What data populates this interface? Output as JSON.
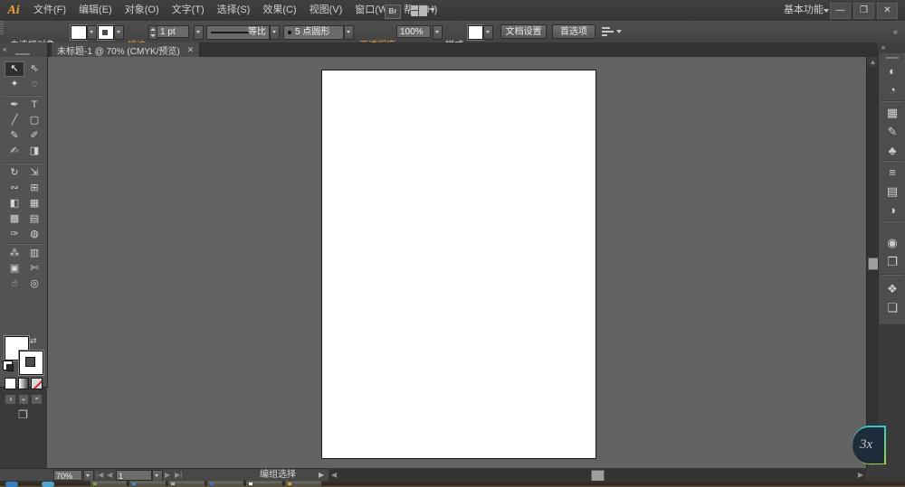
{
  "menu_bar": {
    "logo": "Ai",
    "items": [
      {
        "name": "menu-file",
        "label": "文件(F)"
      },
      {
        "name": "menu-edit",
        "label": "编辑(E)"
      },
      {
        "name": "menu-object",
        "label": "对象(O)"
      },
      {
        "name": "menu-type",
        "label": "文字(T)"
      },
      {
        "name": "menu-select",
        "label": "选择(S)"
      },
      {
        "name": "menu-effect",
        "label": "效果(C)"
      },
      {
        "name": "menu-view",
        "label": "视图(V)"
      },
      {
        "name": "menu-window",
        "label": "窗口(W)"
      },
      {
        "name": "menu-help",
        "label": "帮助(H)"
      }
    ],
    "bridge_label": "Br",
    "workspace_label": "基本功能",
    "window_controls": [
      {
        "name": "minimize-button",
        "glyph": "—"
      },
      {
        "name": "restore-button",
        "glyph": "❐"
      },
      {
        "name": "close-button",
        "glyph": "✕"
      }
    ]
  },
  "control_bar": {
    "selection_status": "未选择对象",
    "stroke_label": "描边:",
    "stroke_weight": "1 pt",
    "stroke_profile": "等比",
    "brush_definition": "5 点圆形",
    "opacity_label": "不透明度:",
    "opacity_value": "100%",
    "style_label": "样式:",
    "document_setup_label": "文档设置",
    "preferences_label": "首选项",
    "collapse_glyph": "«"
  },
  "tab": {
    "title": "未标题-1 @ 70% (CMYK/预览)",
    "close_glyph": "✕"
  },
  "tools": {
    "collapse_glyph": "«",
    "groups": [
      {
        "items": [
          {
            "name": "selection-tool",
            "glyph": "↖",
            "sel": true
          },
          {
            "name": "direct-selection-tool",
            "glyph": "⇖"
          },
          {
            "name": "magic-wand-tool",
            "glyph": "✦"
          },
          {
            "name": "lasso-tool",
            "glyph": "◌"
          }
        ]
      },
      {
        "items": [
          {
            "name": "pen-tool",
            "glyph": "✒"
          },
          {
            "name": "type-tool",
            "glyph": "T"
          },
          {
            "name": "line-segment-tool",
            "glyph": "╱"
          },
          {
            "name": "rectangle-tool",
            "glyph": "▢"
          },
          {
            "name": "paintbrush-tool",
            "glyph": "✎"
          },
          {
            "name": "pencil-tool",
            "glyph": "✐"
          },
          {
            "name": "blob-brush-tool",
            "glyph": "✍"
          },
          {
            "name": "eraser-tool",
            "glyph": "◨"
          }
        ]
      },
      {
        "items": [
          {
            "name": "rotate-tool",
            "glyph": "↻"
          },
          {
            "name": "scale-tool",
            "glyph": "⇲"
          },
          {
            "name": "width-tool",
            "glyph": "∾"
          },
          {
            "name": "free-transform-tool",
            "glyph": "⊞"
          },
          {
            "name": "shape-builder-tool",
            "glyph": "◧"
          },
          {
            "name": "perspective-grid-tool",
            "glyph": "▦"
          },
          {
            "name": "mesh-tool",
            "glyph": "▩"
          },
          {
            "name": "gradient-tool",
            "glyph": "▤"
          },
          {
            "name": "eyedropper-tool",
            "glyph": "✑"
          },
          {
            "name": "blend-tool",
            "glyph": "◍"
          }
        ]
      },
      {
        "items": [
          {
            "name": "symbol-sprayer-tool",
            "glyph": "⁂"
          },
          {
            "name": "column-graph-tool",
            "glyph": "▥"
          },
          {
            "name": "artboard-tool",
            "glyph": "▣"
          },
          {
            "name": "slice-tool",
            "glyph": "✄"
          },
          {
            "name": "hand-tool",
            "glyph": "☝"
          },
          {
            "name": "zoom-tool",
            "glyph": "◎"
          }
        ]
      }
    ],
    "swap-colors-glyph": "⇄",
    "color-modes": [
      {
        "name": "fill-color-mode"
      },
      {
        "name": "gradient-color-mode"
      },
      {
        "name": "none-color-mode"
      }
    ],
    "draw_modes": [
      {
        "name": "draw-normal-mode",
        "glyph": "◑"
      },
      {
        "name": "draw-behind-mode",
        "glyph": "◒"
      },
      {
        "name": "draw-inside-mode",
        "glyph": "◓"
      }
    ],
    "screen_mode_glyph": "❐"
  },
  "dock": {
    "collapse_glyph": "«",
    "groups": [
      {
        "items": [
          {
            "name": "color-panel-icon",
            "glyph": "◐"
          },
          {
            "name": "color-guide-panel-icon",
            "glyph": "◔"
          }
        ]
      },
      {
        "items": [
          {
            "name": "swatches-panel-icon",
            "glyph": "▦"
          },
          {
            "name": "brushes-panel-icon",
            "glyph": "✎"
          },
          {
            "name": "symbols-panel-icon",
            "glyph": "♣"
          }
        ]
      },
      {
        "items": [
          {
            "name": "stroke-panel-icon",
            "glyph": "≡"
          },
          {
            "name": "gradient-panel-icon",
            "glyph": "▤"
          },
          {
            "name": "transparency-panel-icon",
            "glyph": "◑"
          }
        ]
      },
      {
        "items": [
          {
            "name": "appearance-panel-icon",
            "glyph": "◉"
          },
          {
            "name": "graphic-styles-panel-icon",
            "glyph": "❐"
          }
        ]
      },
      {
        "items": [
          {
            "name": "layers-panel-icon",
            "glyph": "❖"
          },
          {
            "name": "artboards-panel-icon",
            "glyph": "❏"
          }
        ]
      }
    ]
  },
  "status_bar": {
    "zoom_value": "70%",
    "first_glyph": "|◀",
    "prev_glyph": "◀",
    "page_value": "1",
    "next_glyph": "▶",
    "last_glyph": "▶|",
    "status_text": "编组选择",
    "popup_glyph": "▶"
  },
  "scrollbars": {
    "up_glyph": "▲",
    "down_glyph": "▼",
    "left_glyph": "◀",
    "right_glyph": "▶"
  },
  "watermark": {
    "label": "3x"
  },
  "taskbar": {
    "quick": [
      {
        "name": "taskbar-quick-1",
        "color": "#3a7fc1"
      },
      {
        "name": "taskbar-quick-2",
        "color": "#4fa3d1"
      }
    ],
    "items": [
      {
        "name": "taskbar-window-1",
        "color": "#6fae3c"
      },
      {
        "name": "taskbar-window-2",
        "color": "#3f8fd0"
      },
      {
        "name": "taskbar-window-3",
        "color": "#b8b0a4"
      },
      {
        "name": "taskbar-window-4",
        "color": "#3f6fd0"
      },
      {
        "name": "taskbar-window-5",
        "color": "#e8eef4"
      },
      {
        "name": "taskbar-window-6",
        "color": "#e09a3a"
      }
    ]
  }
}
